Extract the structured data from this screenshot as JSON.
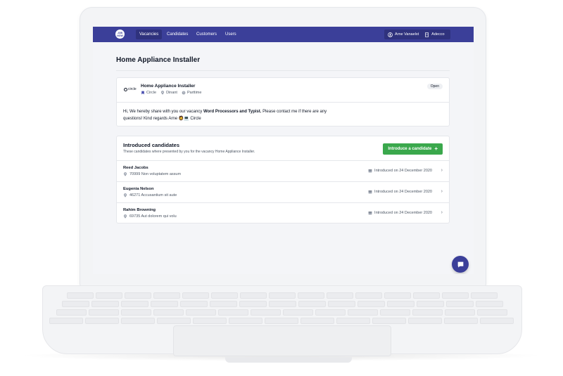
{
  "navbar": {
    "logo_text": "JOB\nNOW",
    "items": [
      {
        "label": "Vacancies",
        "active": true
      },
      {
        "label": "Candidates",
        "active": false
      },
      {
        "label": "Customers",
        "active": false
      },
      {
        "label": "Users",
        "active": false
      }
    ],
    "user_name": "Arne Vanaelst",
    "company": "Adecco",
    "brand_color": "#3b3f99"
  },
  "page": {
    "title": "Home Appliance Installer"
  },
  "vacancy": {
    "company_logo": "circle",
    "title": "Home Appliance Installer",
    "company": "Circle",
    "location": "Dinant",
    "type": "Parttime",
    "status": "Open",
    "message_pre": "Hi, We hereby share with you our vacancy ",
    "message_bold": "Word Processors and Typist.",
    "message_post": " Please contact me if there are any questions! Kind regards Arne 🧔💻 Circle"
  },
  "introduced": {
    "title": "Introduced candidates",
    "subtitle": "These candidates where presented by you for the vacancy Home Appliance Installer.",
    "button_label": "Introduce a candidate",
    "button_color": "#3aa84c",
    "candidates": [
      {
        "name": "Reed Jacobs",
        "address": "70999 Non voluptatem assum",
        "date": "Introduced on 24 December 2020"
      },
      {
        "name": "Eugenia Nelson",
        "address": "46271 Accusantium sit aute",
        "date": "Introduced on 24 December 2020"
      },
      {
        "name": "Rahim Browning",
        "address": "69735 Aut dolorem qui volu",
        "date": "Introduced on 24 December 2020"
      }
    ]
  },
  "icons": {
    "user": "user-circle-icon",
    "company": "building-icon",
    "pin": "map-pin-icon",
    "calendar": "calendar-icon",
    "chevron": "chevron-right-icon",
    "chat": "chat-bubble-icon"
  }
}
